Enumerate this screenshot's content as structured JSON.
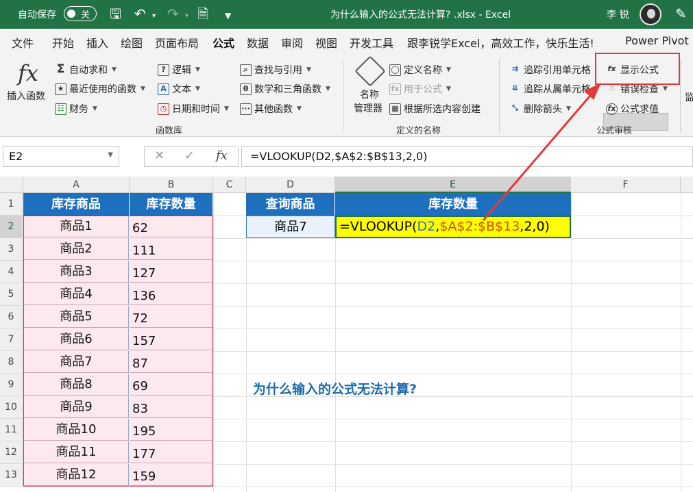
{
  "titlebar": {
    "autosave_label": "自动保存",
    "autosave_state": "关",
    "document_title": "为什么输入的公式无法计算? .xlsx  -  Excel",
    "user_name": "李 锐"
  },
  "menu": {
    "tabs": [
      "文件",
      "开始",
      "插入",
      "绘图",
      "页面布局",
      "公式",
      "数据",
      "审阅",
      "视图",
      "开发工具",
      "跟李锐学Excel，高效工作，快乐生活!",
      "Power Pivot"
    ],
    "active": "公式"
  },
  "ribbon": {
    "insert_function": "插入函数",
    "library": {
      "autosum": "自动求和",
      "recent": "最近使用的函数",
      "financial": "财务",
      "logical": "逻辑",
      "text": "文本",
      "datetime": "日期和时间",
      "lookup": "查找与引用",
      "math": "数学和三角函数",
      "other": "其他函数",
      "group_label": "函数库"
    },
    "names": {
      "name_manager_1": "名称",
      "name_manager_2": "管理器",
      "define_name": "定义名称",
      "use_in_formula": "用于公式",
      "create_from_selection": "根据所选内容创建",
      "group_label": "定义的名称"
    },
    "audit": {
      "trace_precedents": "追踪引用单元格",
      "trace_dependents": "追踪从属单元格",
      "remove_arrows": "删除箭头",
      "show_formulas": "显示公式",
      "error_checking": "错误检查",
      "evaluate_formula": "公式求值",
      "group_label": "公式审核",
      "watch_partial": "监"
    }
  },
  "formula_bar": {
    "name_box": "E2",
    "formula": "=VLOOKUP(D2,$A$2:$B$13,2,0)"
  },
  "columns": [
    "A",
    "B",
    "C",
    "D",
    "E",
    "F"
  ],
  "rows": [
    "1",
    "2",
    "3",
    "4",
    "5",
    "6",
    "7",
    "8",
    "9",
    "10",
    "11",
    "12",
    "13"
  ],
  "table": {
    "header_a": "库存商品",
    "header_b": "库存数量",
    "items": [
      {
        "name": "商品1",
        "qty": "62"
      },
      {
        "name": "商品2",
        "qty": "111"
      },
      {
        "name": "商品3",
        "qty": "127"
      },
      {
        "name": "商品4",
        "qty": "136"
      },
      {
        "name": "商品5",
        "qty": "72"
      },
      {
        "name": "商品6",
        "qty": "157"
      },
      {
        "name": "商品7",
        "qty": "87"
      },
      {
        "name": "商品8",
        "qty": "69"
      },
      {
        "name": "商品9",
        "qty": "83"
      },
      {
        "name": "商品10",
        "qty": "195"
      },
      {
        "name": "商品11",
        "qty": "177"
      },
      {
        "name": "商品12",
        "qty": "159"
      }
    ]
  },
  "lookup": {
    "header_d": "查询商品",
    "header_e": "库存数量",
    "d2": "商品7",
    "e2_parts": [
      "=VLOOKUP(",
      "D2",
      ",",
      "$A$2:$B$13",
      ",2,0)"
    ]
  },
  "note": "为什么输入的公式无法计算?",
  "colors": {
    "excel_green": "#217346",
    "header_blue": "#1f6fbf",
    "highlight_red": "#e23a3a",
    "formula_ref_blue": "#2e6fd6",
    "formula_ref_orange": "#d9480f"
  }
}
